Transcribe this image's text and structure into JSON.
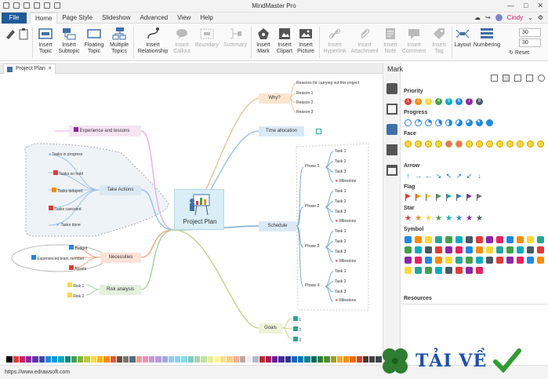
{
  "app": {
    "title": "MindMaster Pro"
  },
  "menu": {
    "file": "File",
    "items": [
      "Home",
      "Page Style",
      "Slideshow",
      "Advanced",
      "View",
      "Help"
    ],
    "user": "Cindy"
  },
  "ribbon": {
    "insert_topic": "Insert\nTopic",
    "insert_subtopic": "Insert\nSubtopic",
    "floating_topic": "Floating\nTopic",
    "multiple_topics": "Multiple\nTopics",
    "insert_relationship": "Insert\nRelationship",
    "insert_callout": "Insert\nCallout",
    "boundary": "Boundary",
    "summary": "Summary",
    "insert_mark": "Insert\nMark",
    "insert_clipart": "Insert\nClipart",
    "insert_picture": "Insert\nPicture",
    "insert_hyperlink": "Insert\nHyperlink",
    "insert_attachment": "Insert\nAttachment",
    "insert_note": "Insert\nNote",
    "insert_comment": "Insert\nComment",
    "insert_tag": "Insert\nTag",
    "layout": "Layout",
    "numbering": "Numbering",
    "spin1": "30",
    "spin2": "30",
    "reset": "Reset"
  },
  "doc_tab": {
    "label": "Project Plan"
  },
  "mindmap": {
    "central": "Project Plan",
    "why": "Why?",
    "why_items": [
      "Reasons for carrying out this project",
      "Reason 1",
      "Reason 2",
      "Reason 3"
    ],
    "time_allocation": "Time allocation",
    "schedule": "Schedule",
    "phases": [
      "Phase 1",
      "Phase 2",
      "Phase 3",
      "Phase 4"
    ],
    "tasks": [
      "Task 1",
      "Task 2",
      "Task 3"
    ],
    "milestone": "Milestone",
    "goals": "Goals",
    "goal_items": [
      "1",
      "2",
      "3"
    ],
    "experience": "Experience and lessons",
    "take_actions": "Take Actions",
    "action_items": [
      "Tasks in progress",
      "Tasks on hold",
      "Tasks delayed",
      "Tasks canceled",
      "Tasks done"
    ],
    "necessities": "Necessities",
    "necessity_items": [
      "Budget",
      "Experienced team member",
      "Assets"
    ],
    "risk": "Risk analysis",
    "risk_items": [
      "Risk 1",
      "Risk 2"
    ]
  },
  "panel": {
    "title": "Mark",
    "sections": {
      "priority": "Priority",
      "progress": "Progress",
      "face": "Face",
      "arrow": "Arrow",
      "flag": "Flag",
      "star": "Star",
      "symbol": "Symbol",
      "resources": "Resources"
    },
    "priority_numbers": [
      "1",
      "2",
      "3",
      "4",
      "5",
      "6",
      "7",
      "8"
    ],
    "priority_colors": [
      "#e53935",
      "#fb8c00",
      "#fdd835",
      "#43a047",
      "#00acc1",
      "#1e88e5",
      "#8e24aa",
      "#455a64"
    ],
    "flag_colors": [
      "#e53935",
      "#fb8c00",
      "#fdd835",
      "#43a047",
      "#00acc1",
      "#1e88e5",
      "#8e24aa",
      "#757575"
    ],
    "star_colors": [
      "#e53935",
      "#fb8c00",
      "#fdd835",
      "#43a047",
      "#00acc1",
      "#1e88e5",
      "#8e24aa",
      "#455a64"
    ]
  },
  "status": {
    "url": "https://www.edrawsoft.com"
  },
  "watermark": {
    "text": "TẢI VỀ"
  }
}
